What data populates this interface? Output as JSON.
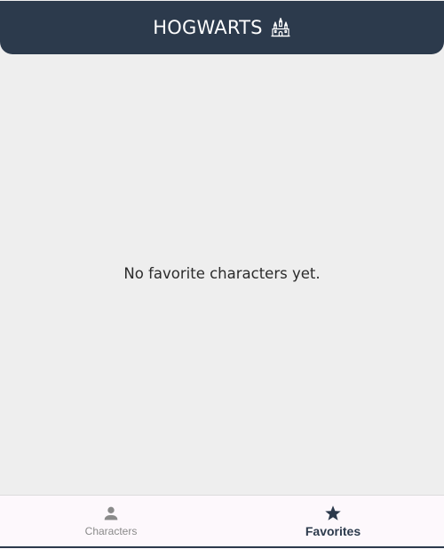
{
  "header": {
    "title": "HOGWARTS",
    "icon": "castle-icon"
  },
  "main": {
    "empty_message": "No favorite characters yet."
  },
  "bottom_nav": {
    "items": [
      {
        "label": "Characters",
        "icon": "person-icon",
        "active": false
      },
      {
        "label": "Favorites",
        "icon": "star-icon",
        "active": true
      }
    ]
  },
  "colors": {
    "header_bg": "#2c3a4c",
    "page_bg": "#eeeeee",
    "nav_bg": "#fdf8fc",
    "active": "#2c3a4c",
    "inactive": "#8a8a8a"
  }
}
